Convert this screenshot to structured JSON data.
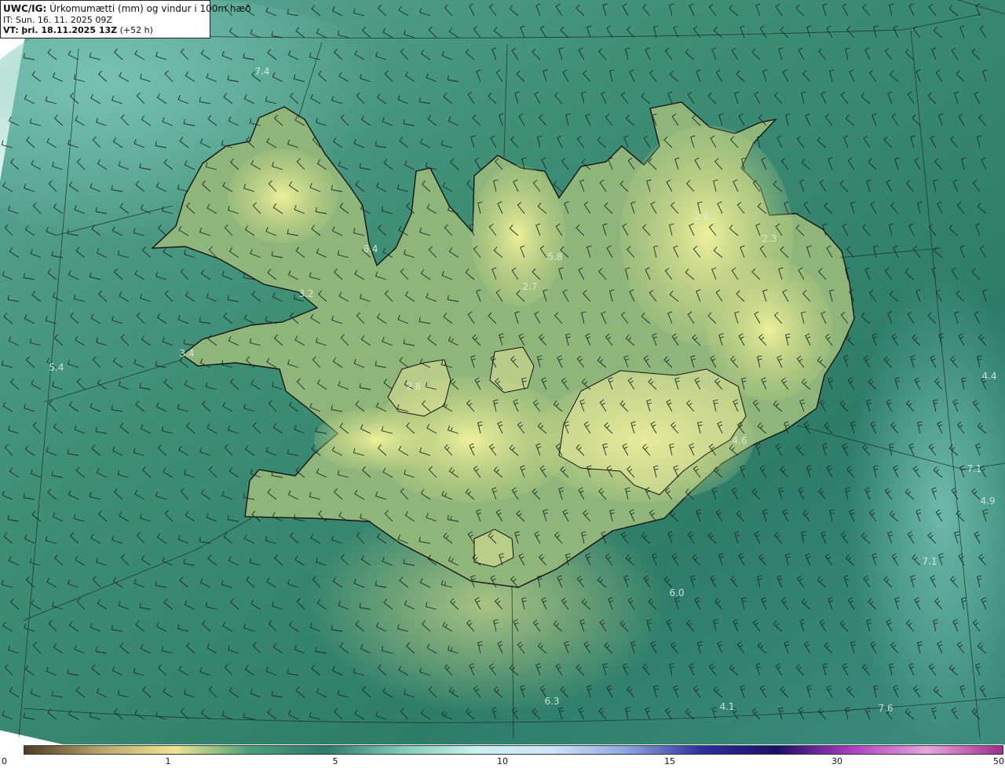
{
  "header": {
    "code": "UWC/IG:",
    "title": "Úrkomumætti (mm) og vindur i 100m hæð",
    "init_time": "IT: Sun. 16. 11. 2025 09Z",
    "valid_prefix": "VT:",
    "valid_time": "þri. 18.11.2025 13Z",
    "lead": "(+52 h)"
  },
  "colorbar": {
    "ticks": [
      "0",
      "1",
      "5",
      "10",
      "15",
      "30",
      "50"
    ],
    "stops": [
      "#4e3b22",
      "#b8a46a",
      "#f0e592",
      "#4aa07a",
      "#2c7a6d",
      "#7fc9bb",
      "#c8f2ee",
      "#cfe4f7",
      "#8fa6e2",
      "#2d2f9c",
      "#1a0f66",
      "#ad3fc0",
      "#e7a6db",
      "#9e2c8e"
    ]
  },
  "map": {
    "colors": {
      "sea": "#2e7f6b",
      "land_high": "#dfe58e",
      "land_mid": "#9bbf7c",
      "coast": "#141414",
      "wind": "#1d2b24"
    },
    "value_labels": [
      "7.4",
      "6.4",
      "5.8",
      "2.7",
      "2.6",
      "2.3",
      "3.2",
      "3.4",
      "5.4",
      "4.4",
      "4.6",
      "7.1",
      "4.9",
      "7.1",
      "6.0",
      "6.3",
      "4.1",
      "7.6",
      "2.8"
    ]
  }
}
